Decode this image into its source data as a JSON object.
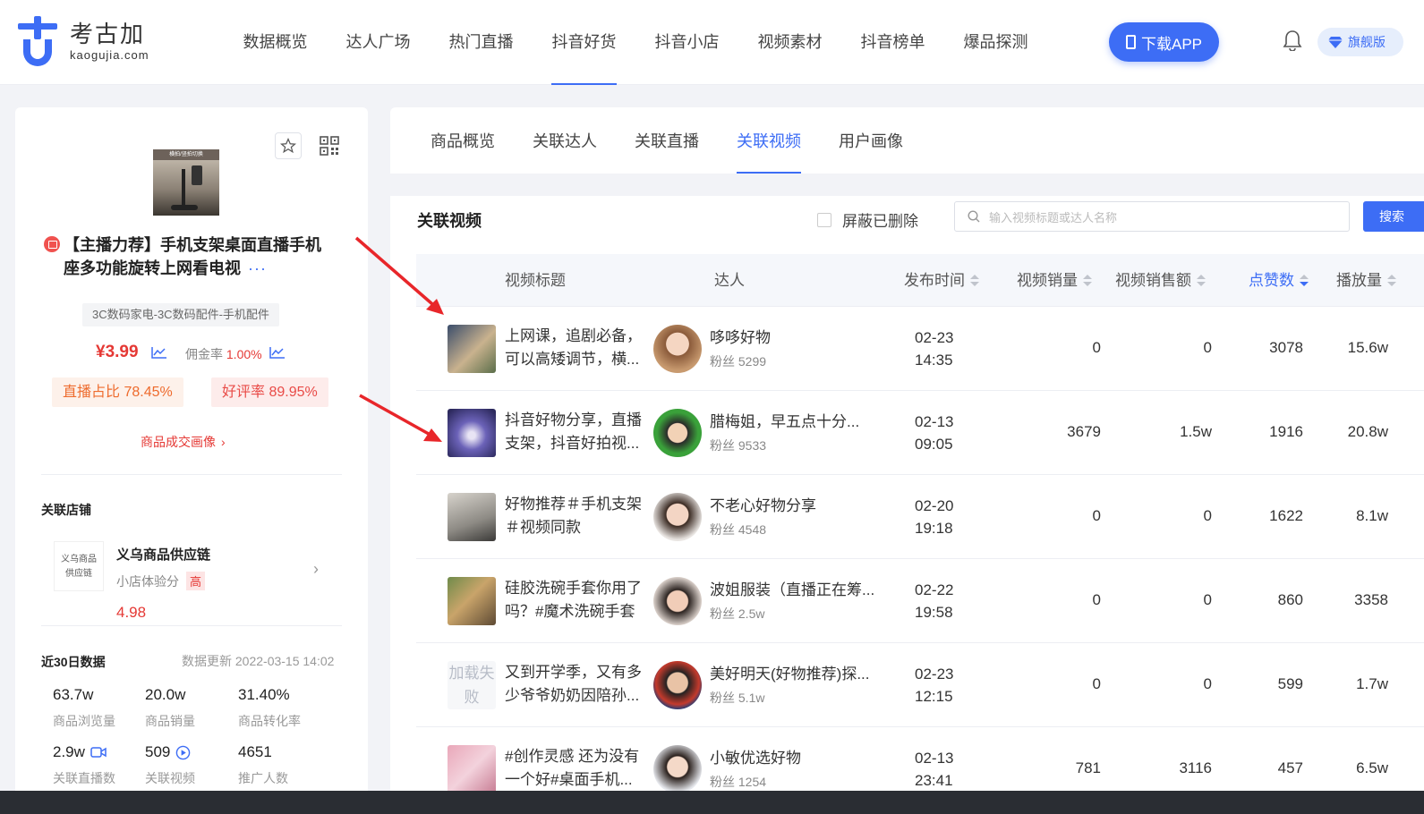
{
  "brand": {
    "name_cn": "考古加",
    "name_en": "kaogujia.com",
    "accent": "#3d6df5"
  },
  "nav": {
    "items": [
      "数据概览",
      "达人广场",
      "热门直播",
      "抖音好货",
      "抖音小店",
      "视频素材",
      "抖音榜单",
      "爆品探测"
    ],
    "active_index": 3,
    "download_label": "下载APP",
    "vip_label": "旗舰版"
  },
  "product": {
    "thumb_caption": "横拍/竖拍切换",
    "title": "【主播力荐】手机支架桌面直播手机座多功能旋转上网看电视",
    "more": "···",
    "category": "3C数码家电-3C数码配件-手机配件",
    "price": "¥3.99",
    "commission_label": "佣金率",
    "commission_value": "1.00%",
    "live_ratio_label": "直播占比",
    "live_ratio_value": "78.45%",
    "good_rate_label": "好评率",
    "good_rate_value": "89.95%",
    "deal_portrait_link": "商品成交画像"
  },
  "store": {
    "section_title": "关联店铺",
    "logo_line1": "义乌商品",
    "logo_line2": "供应链",
    "name": "义乌商品供应链",
    "score_label": "小店体验分",
    "score_value": "4.98",
    "score_level": "高"
  },
  "recent": {
    "section_title": "近30日数据",
    "update_text": "数据更新 2022-03-15 14:02",
    "metrics": [
      {
        "value": "63.7w",
        "label": "商品浏览量"
      },
      {
        "value": "20.0w",
        "label": "商品销量"
      },
      {
        "value": "31.40%",
        "label": "商品转化率"
      },
      {
        "value": "2.9w",
        "label": "关联直播数"
      },
      {
        "value": "509",
        "label": "关联视频"
      },
      {
        "value": "4651",
        "label": "推广人数"
      }
    ]
  },
  "tabs": {
    "items": [
      "商品概览",
      "关联达人",
      "关联直播",
      "关联视频",
      "用户画像"
    ],
    "active_index": 3
  },
  "videos": {
    "title": "关联视频",
    "hide_deleted_label": "屏蔽已删除",
    "search_placeholder": "输入视频标题或达人名称",
    "search_button": "搜索",
    "columns": {
      "title": "视频标题",
      "kol": "达人",
      "pubtime": "发布时间",
      "sales": "视频销量",
      "amount": "视频销售额",
      "likes": "点赞数",
      "plays": "播放量"
    },
    "rows": [
      {
        "title": "上网课，追剧必备，可以高矮调节，横...",
        "kol": "哆哆好物",
        "fans": "粉丝 5299",
        "date": "02-23",
        "time": "14:35",
        "sales": "0",
        "amount": "0",
        "likes": "3078",
        "plays": "15.6w"
      },
      {
        "title": "抖音好物分享，直播支架，抖音好拍视...",
        "kol": "腊梅姐，早五点十分...",
        "fans": "粉丝 9533",
        "date": "02-13",
        "time": "09:05",
        "sales": "3679",
        "amount": "1.5w",
        "likes": "1916",
        "plays": "20.8w"
      },
      {
        "title": "好物推荐＃手机支架＃视频同款",
        "kol": "不老心好物分享",
        "fans": "粉丝 4548",
        "date": "02-20",
        "time": "19:18",
        "sales": "0",
        "amount": "0",
        "likes": "1622",
        "plays": "8.1w"
      },
      {
        "title": "硅胶洗碗手套你用了吗？#魔术洗碗手套",
        "kol": "波姐服装（直播正在筹...",
        "fans": "粉丝 2.5w",
        "date": "02-22",
        "time": "19:58",
        "sales": "0",
        "amount": "0",
        "likes": "860",
        "plays": "3358"
      },
      {
        "title": "又到开学季，又有多少爷爷奶奶因陪孙...",
        "kol": "美好明天(好物推荐)探...",
        "fans": "粉丝 5.1w",
        "date": "02-23",
        "time": "12:15",
        "sales": "0",
        "amount": "0",
        "likes": "599",
        "plays": "1.7w",
        "thumb_failed": "加载失败"
      },
      {
        "title": "#创作灵感 还为没有一个好#桌面手机...",
        "kol": "小敏优选好物",
        "fans": "粉丝 1254",
        "date": "02-13",
        "time": "23:41",
        "sales": "781",
        "amount": "3116",
        "likes": "457",
        "plays": "6.5w"
      }
    ]
  }
}
